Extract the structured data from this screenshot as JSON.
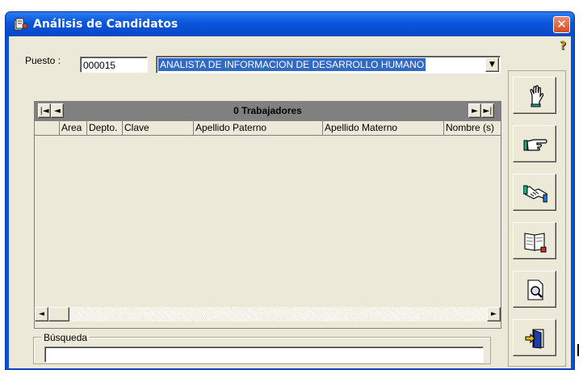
{
  "window": {
    "title": "Análisis de Candidatos",
    "close_label": "✕",
    "help_glyph": "?"
  },
  "puesto": {
    "label": "Puesto :",
    "code": "000015",
    "name": "ANALISTA DE INFORMACION DE DESARROLLO HUMANO"
  },
  "grid": {
    "count_label": "0 Trabajadores",
    "nav": {
      "first": "|◄",
      "prev": "◄",
      "next": "►",
      "last": "►|"
    },
    "columns": [
      "",
      "Area",
      "Depto.",
      "Clave",
      "Apellido Paterno",
      "Apellido Materno",
      "Nombre (s)"
    ],
    "rows": []
  },
  "search": {
    "group_label": "Búsqueda",
    "value": ""
  },
  "toolbar": {
    "buttons": [
      {
        "icon": "raised-hand-icon"
      },
      {
        "icon": "pointing-hand-icon"
      },
      {
        "icon": "handshake-icon"
      },
      {
        "icon": "book-icon"
      },
      {
        "icon": "print-preview-icon"
      },
      {
        "icon": "exit-door-icon"
      }
    ]
  },
  "colors": {
    "title_bar": "#0a55dc",
    "face": "#ece9d8",
    "selection": "#316ac5",
    "grid_nav": "#808080",
    "close_button": "#d9491f"
  }
}
